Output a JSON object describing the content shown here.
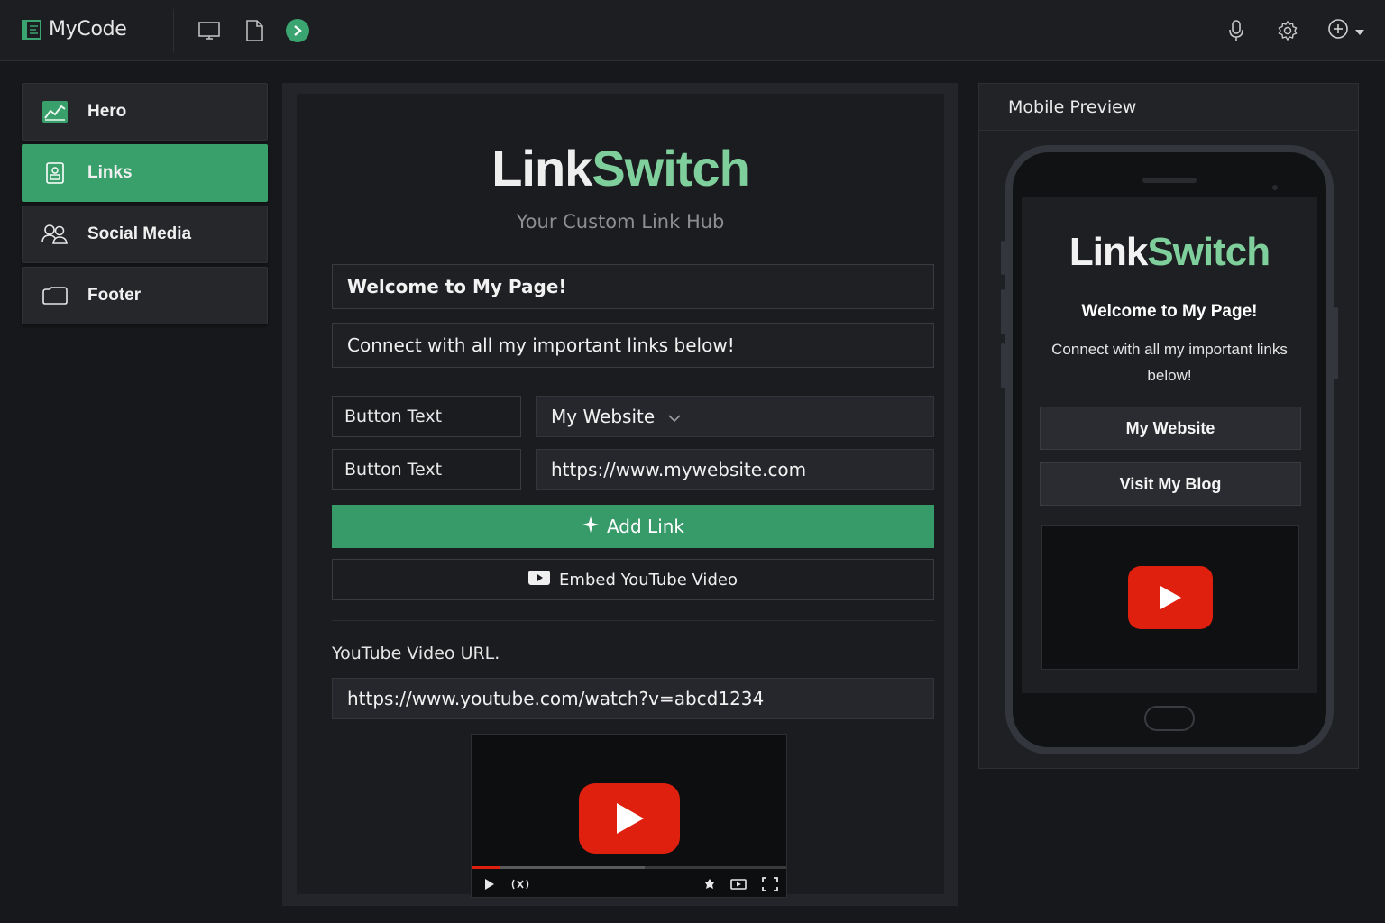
{
  "app": {
    "name": "MyCode"
  },
  "toolbar": {
    "icons": [
      "monitor-icon",
      "file-icon",
      "run-icon",
      "microphone-icon",
      "gear-icon",
      "add-circle-icon",
      "caret-down-icon"
    ]
  },
  "sidebar": {
    "items": [
      {
        "label": "Hero",
        "icon": "chart-icon",
        "active": false
      },
      {
        "label": "Links",
        "icon": "contact-card-icon",
        "active": true
      },
      {
        "label": "Social Media",
        "icon": "people-icon",
        "active": false
      },
      {
        "label": "Footer",
        "icon": "footer-icon",
        "active": false
      }
    ]
  },
  "editor": {
    "brand_part1": "Link",
    "brand_part2": "Switch",
    "tagline": "Your Custom Link Hub",
    "title_value": "Welcome to My Page!",
    "subtitle_value": "Connect with all my important links below!",
    "rows": [
      {
        "label": "Button Text",
        "value": "My Website"
      },
      {
        "label": "Button Text",
        "value": "https://www.mywebsite.com"
      }
    ],
    "add_link_label": "Add Link",
    "embed_label": "Embed YouTube Video",
    "youtube_label": "YouTube Video URL.",
    "youtube_value": "https://www.youtube.com/watch?v=abcd1234",
    "video_progress": 0.09,
    "video_buffered": 0.55
  },
  "preview": {
    "header": "Mobile Preview",
    "brand_part1": "Link",
    "brand_part2": "Switch",
    "title": "Welcome to My Page!",
    "subtitle": "Connect with all my important links below!",
    "buttons": [
      "My Website",
      "Visit My Blog"
    ]
  },
  "colors": {
    "accent": "#3aa571",
    "brand_green": "#7fcf9c",
    "youtube_red": "#e0200f",
    "background": "#17181b"
  }
}
